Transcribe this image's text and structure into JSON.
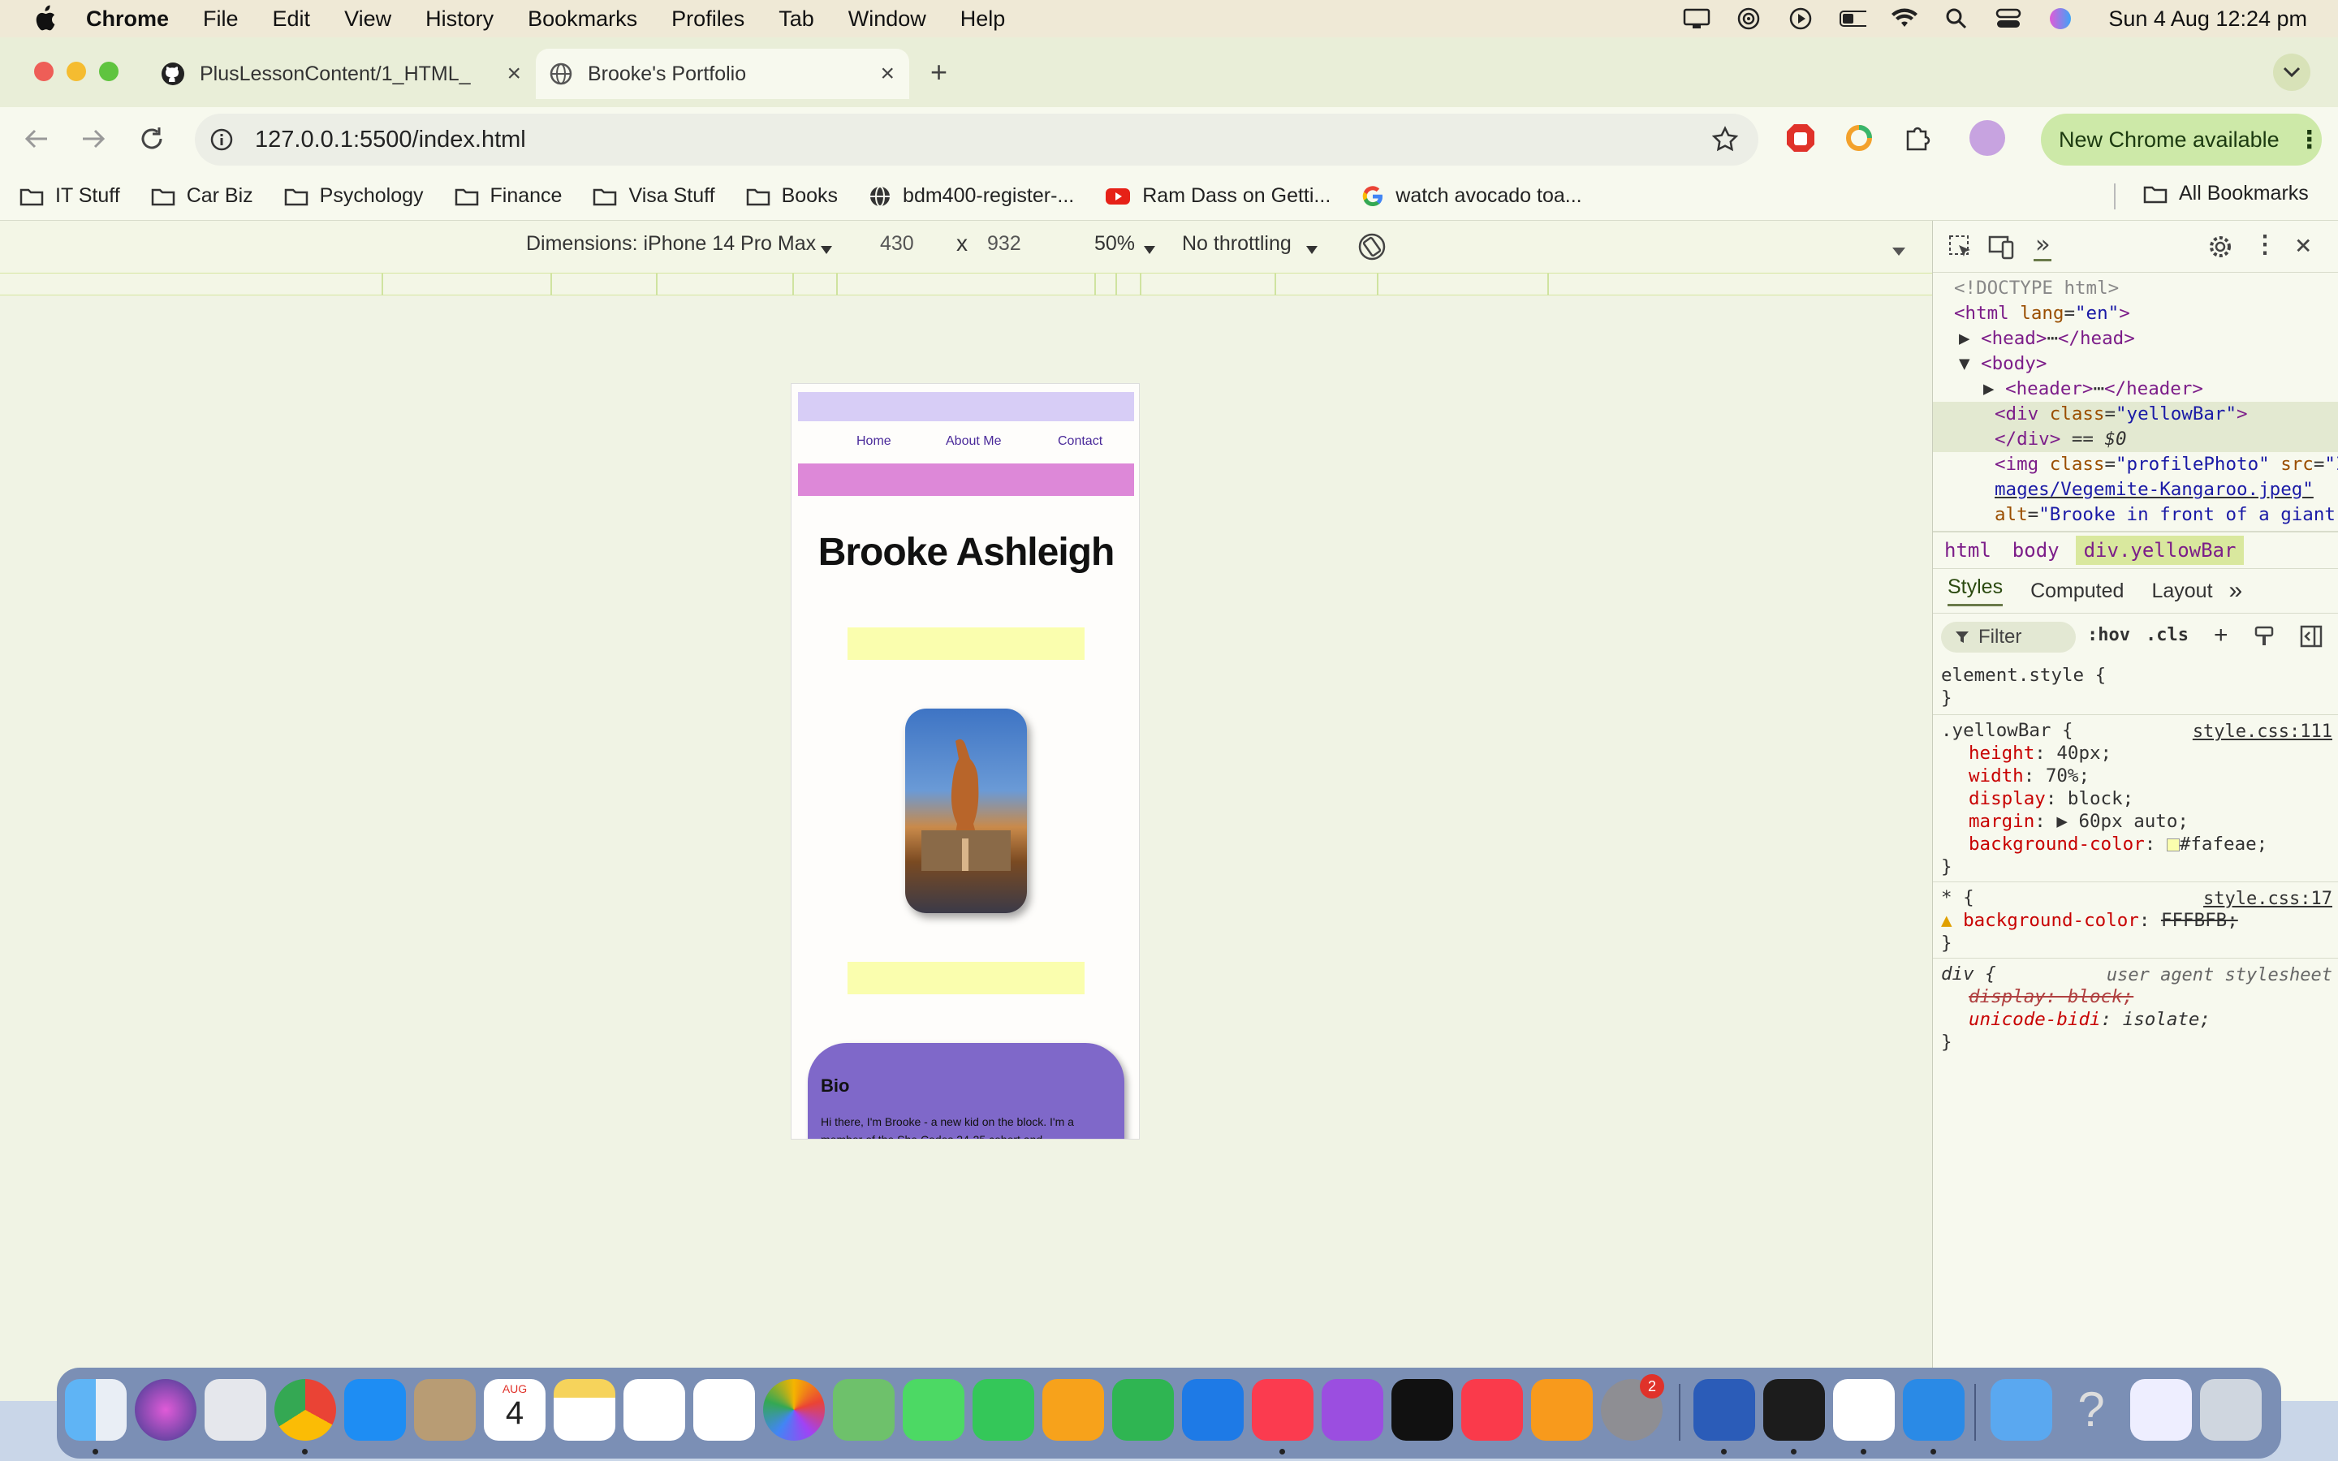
{
  "menubar": {
    "app": "Chrome",
    "items": [
      "File",
      "Edit",
      "View",
      "History",
      "Bookmarks",
      "Profiles",
      "Tab",
      "Window",
      "Help"
    ],
    "clock": "Sun 4 Aug  12:24 pm"
  },
  "tabs": [
    {
      "title": "PlusLessonContent/1_HTML_",
      "active": false
    },
    {
      "title": "Brooke's Portfolio",
      "active": true
    }
  ],
  "toolbar": {
    "url": "127.0.0.1:5500/index.html",
    "update_button": "New Chrome available"
  },
  "bookmarks": [
    {
      "label": "IT Stuff",
      "icon": "folder-icon"
    },
    {
      "label": "Car Biz",
      "icon": "folder-icon"
    },
    {
      "label": "Psychology",
      "icon": "folder-icon"
    },
    {
      "label": "Finance",
      "icon": "folder-icon"
    },
    {
      "label": "Visa Stuff",
      "icon": "folder-icon"
    },
    {
      "label": "Books",
      "icon": "folder-icon"
    },
    {
      "label": "bdm400-register-...",
      "icon": "globe-icon"
    },
    {
      "label": "Ram Dass on Getti...",
      "icon": "youtube-icon"
    },
    {
      "label": "watch avocado toa...",
      "icon": "google-icon"
    }
  ],
  "all_bookmarks": "All Bookmarks",
  "device_toolbar": {
    "dimensions": "Dimensions: iPhone 14 Pro Max",
    "width": "430",
    "x": "x",
    "height": "932",
    "zoom": "50%",
    "throttle": "No throttling"
  },
  "page": {
    "nav": [
      "Home",
      "About Me",
      "Contact"
    ],
    "name": "Brooke Ashleigh",
    "bio_title": "Bio",
    "bio_text": "Hi there, I'm Brooke - a new kid on the block. I'm a member of the She Codes 24-25 cohort and"
  },
  "devtools": {
    "breadcrumbs": [
      "html",
      "body",
      "div.yellowBar"
    ],
    "style_tabs": [
      "Styles",
      "Computed",
      "Layout"
    ],
    "filter_placeholder": "Filter",
    "hov": ":hov",
    "cls": ".cls",
    "element_style": "element.style {",
    "rule1_selector": ".yellowBar {",
    "rule1_source": "style.css:111",
    "rule1_props": [
      {
        "name": "height",
        "value": "40px;"
      },
      {
        "name": "width",
        "value": "70%;"
      },
      {
        "name": "display",
        "value": "block;"
      },
      {
        "name": "margin",
        "value": "60px auto;"
      },
      {
        "name": "background-color",
        "value": "#fafeae;"
      }
    ],
    "rule2_selector": "* {",
    "rule2_source": "style.css:17",
    "rule2_prop": "background-color",
    "rule2_value": "FFFBFB;",
    "rule3_selector": "div {",
    "rule3_source": "user agent stylesheet",
    "rule3_prop1": "display: block;",
    "rule3_prop2_name": "unicode-bidi",
    "rule3_prop2_value": "isolate;",
    "close_brace": "}"
  },
  "dock": {
    "calendar_month": "AUG",
    "calendar_day": "4",
    "settings_badge": "2"
  },
  "colors": {
    "lavender_bar": "#d7cdf6",
    "pink_bar": "#dd88d8",
    "yellow_bar": "#fafeae",
    "bio_card": "#7f68c9",
    "nav_link": "#4a2a9a"
  }
}
